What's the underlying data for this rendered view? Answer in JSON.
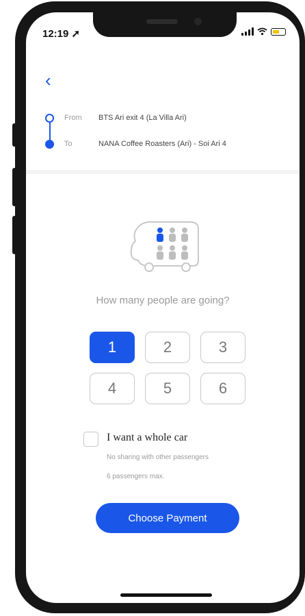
{
  "status": {
    "time": "12:19 ➚"
  },
  "nav": {
    "back_icon": "chevron-left-icon"
  },
  "route": {
    "from_label": "From",
    "from_value": "BTS Ari exit 4 (La Villa Ari)",
    "to_label": "To",
    "to_value": "NANA Coffee Roasters (Ari) - Soi Ari 4"
  },
  "question": "How many people are going?",
  "passengers": {
    "options": [
      "1",
      "2",
      "3",
      "4",
      "5",
      "6"
    ],
    "selected": "1"
  },
  "whole_car": {
    "label": "I want a whole car",
    "note1": "No sharing with other passengers",
    "note2": "6 passengers max."
  },
  "cta": {
    "label": "Choose Payment"
  },
  "colors": {
    "accent": "#1a57e8"
  }
}
